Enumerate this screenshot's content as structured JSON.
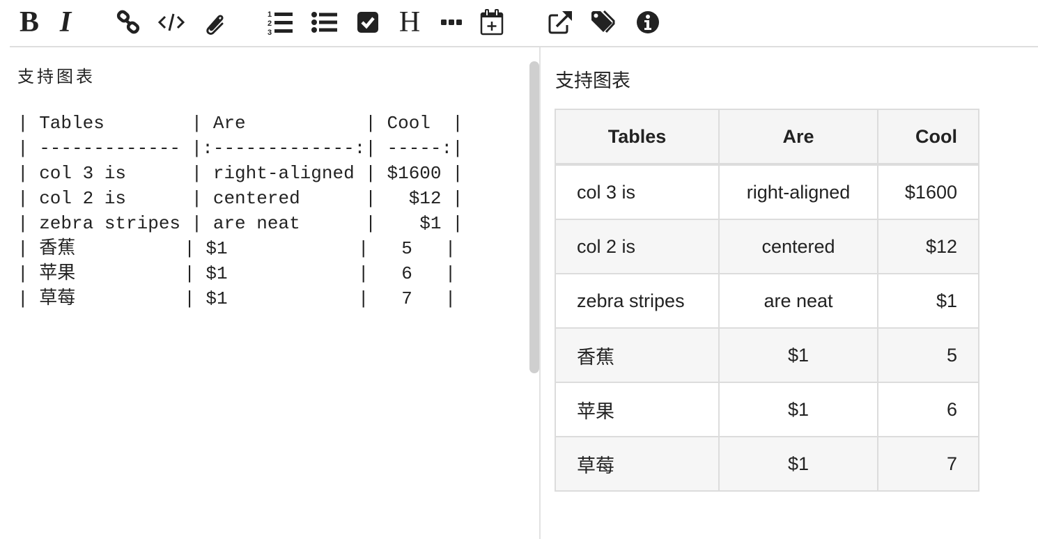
{
  "toolbar": {
    "buttons": [
      {
        "name": "bold",
        "glyph": "B"
      },
      {
        "name": "italic",
        "glyph": "I"
      },
      {
        "name": "link"
      },
      {
        "name": "code"
      },
      {
        "name": "attachment"
      },
      {
        "name": "ordered-list"
      },
      {
        "name": "unordered-list"
      },
      {
        "name": "checkbox"
      },
      {
        "name": "heading",
        "glyph": "H"
      },
      {
        "name": "more"
      },
      {
        "name": "insert-date"
      },
      {
        "name": "external-link"
      },
      {
        "name": "tags"
      },
      {
        "name": "info"
      }
    ]
  },
  "editor": {
    "title": "支持图表",
    "lines": [
      "| Tables        | Are           | Cool  |",
      "| ------------- |:-------------:| -----:|",
      "| col 3 is      | right-aligned | $1600 |",
      "| col 2 is      | centered      |   $12 |",
      "| zebra stripes | are neat      |    $1 |",
      "| 香蕉          | $1            |   5   |",
      "| 苹果          | $1            |   6   |",
      "| 草莓          | $1            |   7   |"
    ]
  },
  "preview": {
    "title": "支持图表",
    "table": {
      "headers": [
        "Tables",
        "Are",
        "Cool"
      ],
      "rows": [
        [
          "col 3 is",
          "right-aligned",
          "$1600"
        ],
        [
          "col 2 is",
          "centered",
          "$12"
        ],
        [
          "zebra stripes",
          "are neat",
          "$1"
        ],
        [
          "香蕉",
          "$1",
          "5"
        ],
        [
          "苹果",
          "$1",
          "6"
        ],
        [
          "草莓",
          "$1",
          "7"
        ]
      ]
    }
  }
}
